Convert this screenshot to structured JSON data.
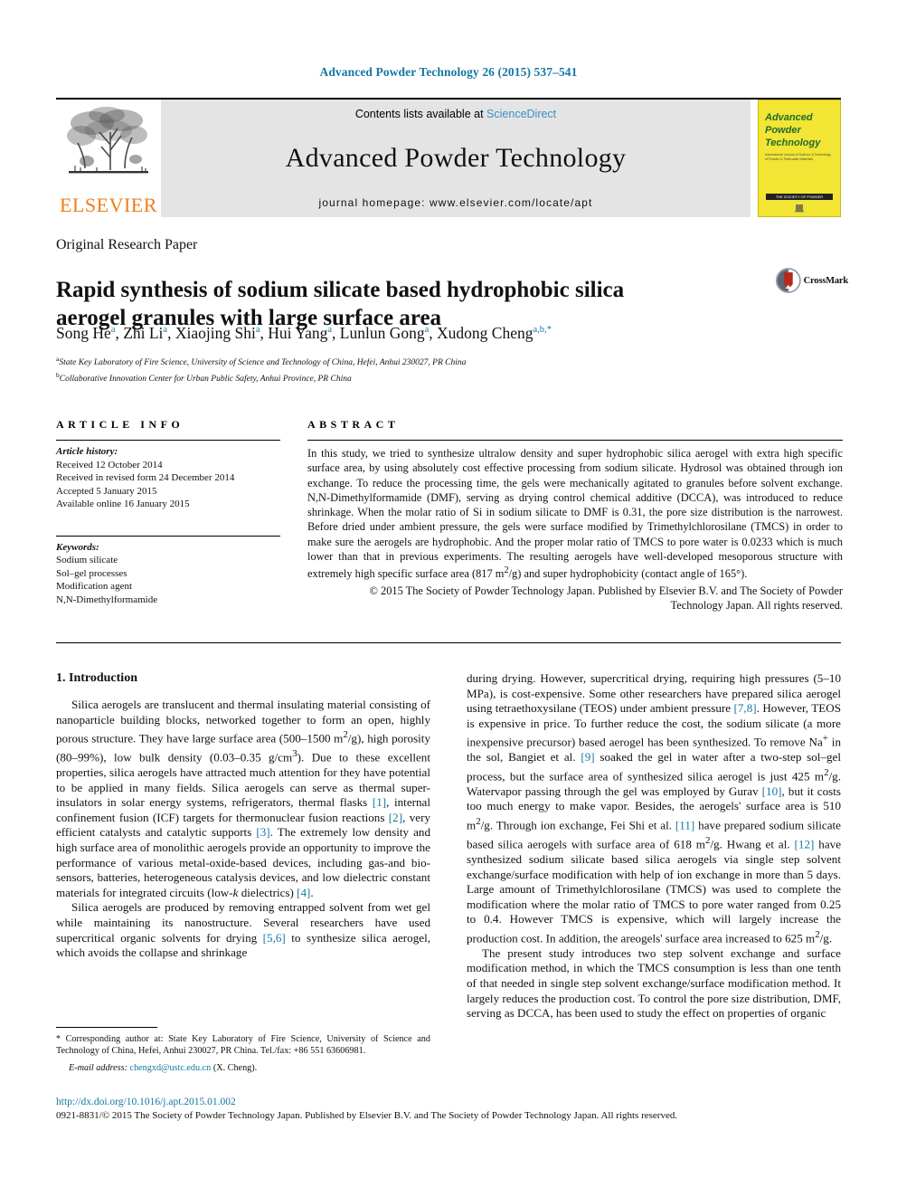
{
  "running_head": "Advanced Powder Technology 26 (2015) 537–541",
  "masthead": {
    "publisher_logo_label": "ELSEVIER",
    "contents_prefix": "Contents lists available at",
    "contents_link": "ScienceDirect",
    "journal_name": "Advanced Powder Technology",
    "homepage_label": "journal homepage: www.elsevier.com/locate/apt",
    "cover": {
      "line1": "Advanced",
      "line2": "Powder",
      "line3": "Technology",
      "subtitle": "International Journal of Science & Technology of Powder & Particulate Materials",
      "bar_text": "THE SOCIETY OF POWDER TECHNOLOGY, JAPAN"
    }
  },
  "article": {
    "type": "Original Research Paper",
    "title": "Rapid synthesis of sodium silicate based hydrophobic silica aerogel granules with large surface area",
    "crossmark_label": "CrossMark",
    "authors": [
      {
        "name": "Song He",
        "sup": "a"
      },
      {
        "name": "Zhi Li",
        "sup": "a"
      },
      {
        "name": "Xiaojing Shi",
        "sup": "a"
      },
      {
        "name": "Hui Yang",
        "sup": "a"
      },
      {
        "name": "Lunlun Gong",
        "sup": "a"
      },
      {
        "name": "Xudong Cheng",
        "sup": "a,b,*"
      }
    ],
    "affiliations": [
      {
        "sup": "a",
        "text": "State Key Laboratory of Fire Science, University of Science and Technology of China, Hefei, Anhui 230027, PR China"
      },
      {
        "sup": "b",
        "text": "Collaborative Innovation Center for Urban Public Safety, Anhui Province, PR China"
      }
    ]
  },
  "article_info": {
    "heading": "ARTICLE INFO",
    "history_label": "Article history:",
    "history": [
      "Received 12 October 2014",
      "Received in revised form 24 December 2014",
      "Accepted 5 January 2015",
      "Available online 16 January 2015"
    ],
    "keywords_label": "Keywords:",
    "keywords": [
      "Sodium silicate",
      "Sol–gel processes",
      "Modification agent",
      "N,N-Dimethylformamide"
    ]
  },
  "abstract": {
    "heading": "ABSTRACT",
    "text": "In this study, we tried to synthesize ultralow density and super hydrophobic silica aerogel with extra high specific surface area, by using absolutely cost effective processing from sodium silicate. Hydrosol was obtained through ion exchange. To reduce the processing time, the gels were mechanically agitated to granules before solvent exchange. N,N-Dimethylformamide (DMF), serving as drying control chemical additive (DCCA), was introduced to reduce shrinkage. When the molar ratio of Si in sodium silicate to DMF is 0.31, the pore size distribution is the narrowest. Before dried under ambient pressure, the gels were surface modified by Trimethylchlorosilane (TMCS) in order to make sure the aerogels are hydrophobic. And the proper molar ratio of TMCS to pore water is 0.0233 which is much lower than that in previous experiments. The resulting aerogels have well-developed mesoporous structure with extremely high specific surface area (817 m2/g) and super hydrophobicity (contact angle of 165°).",
    "copyright_line1": "© 2015 The Society of Powder Technology Japan. Published by Elsevier B.V. and The Society of Powder",
    "copyright_line2": "Technology Japan. All rights reserved."
  },
  "intro": {
    "heading": "1. Introduction",
    "left_paragraphs": [
      "Silica aerogels are translucent and thermal insulating material consisting of nanoparticle building blocks, networked together to form an open, highly porous structure. They have large surface area (500–1500 m2/g), high porosity (80–99%), low bulk density (0.03–0.35 g/cm3). Due to these excellent properties, silica aerogels have attracted much attention for they have potential to be applied in many fields. Silica aerogels can serve as thermal super-insulators in solar energy systems, refrigerators, thermal flasks [1], internal confinement fusion (ICF) targets for thermonuclear fusion reactions [2], very efficient catalysts and catalytic supports [3]. The extremely low density and high surface area of monolithic aerogels provide an opportunity to improve the performance of various metal-oxide-based devices, including gas-and bio-sensors, batteries, heterogeneous catalysis devices, and low dielectric constant materials for integrated circuits (low-k dielectrics) [4].",
      "Silica aerogels are produced by removing entrapped solvent from wet gel while maintaining its nanostructure. Several researchers have used supercritical organic solvents for drying [5,6] to synthesize silica aerogel, which avoids the collapse and shrinkage"
    ],
    "right_paragraphs": [
      "during drying. However, supercritical drying, requiring high pressures (5–10 MPa), is cost-expensive. Some other researchers have prepared silica aerogel using tetraethoxysilane (TEOS) under ambient pressure [7,8]. However, TEOS is expensive in price. To further reduce the cost, the sodium silicate (a more inexpensive precursor) based aerogel has been synthesized. To remove Na+ in the sol, Bangiet et al. [9] soaked the gel in water after a two-step sol–gel process, but the surface area of synthesized silica aerogel is just 425 m2/g. Watervapor passing through the gel was employed by Gurav [10], but it costs too much energy to make vapor. Besides, the aerogels' surface area is 510 m2/g. Through ion exchange, Fei Shi et al. [11] have prepared sodium silicate based silica aerogels with surface area of 618 m2/g. Hwang et al. [12] have synthesized sodium silicate based silica aerogels via single step solvent exchange/surface modification with help of ion exchange in more than 5 days. Large amount of Trimethylchlorosilane (TMCS) was used to complete the modification where the molar ratio of TMCS to pore water ranged from 0.25 to 0.4. However TMCS is expensive, which will largely increase the production cost. In addition, the areogels' surface area increased to 625 m2/g.",
      "The present study introduces two step solvent exchange and surface modification method, in which the TMCS consumption is less than one tenth of that needed in single step solvent exchange/surface modification method. It largely reduces the production cost. To control the pore size distribution, DMF, serving as DCCA, has been used to study the effect on properties of organic"
    ]
  },
  "footnote": {
    "star": "*",
    "text": "Corresponding author at: State Key Laboratory of Fire Science, University of Science and Technology of China, Hefei, Anhui 230027, PR China. Tel./fax: +86 551 63606981.",
    "email_label": "E-mail address:",
    "email": "chengxd@ustc.edu.cn",
    "email_suffix": "(X. Cheng)."
  },
  "bottom": {
    "doi": "http://dx.doi.org/10.1016/j.apt.2015.01.002",
    "issn_line": "0921-8831/© 2015 The Society of Powder Technology Japan. Published by Elsevier B.V. and The Society of Powder Technology Japan. All rights reserved."
  },
  "colors": {
    "link": "#1477a3",
    "elsevier_orange": "#ef7d1a",
    "cover_yellow": "#f2e533",
    "cover_green": "#1f6b32",
    "band_gray": "#e4e4e4"
  }
}
